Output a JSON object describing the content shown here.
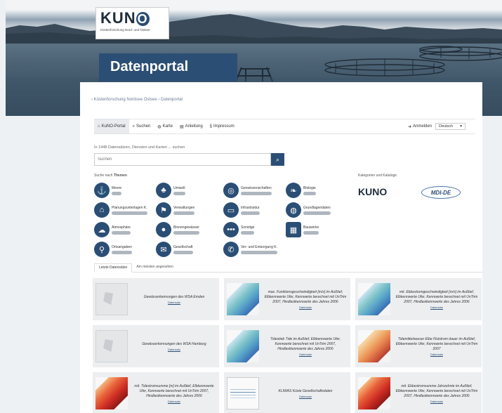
{
  "logo": {
    "name": "KUNO",
    "subtitle": "Küstenforschung Nord- und Ostsee"
  },
  "portal_title": "Datenportal",
  "breadcrumb": {
    "text": "› Küstenforschung Nordsee Ostsee  ›  Datenportal"
  },
  "nav": {
    "items": [
      {
        "icon": "home",
        "label": "KuNO-Portal"
      },
      {
        "icon": "search",
        "label": "Suchen"
      },
      {
        "icon": "globe",
        "label": "Karte"
      },
      {
        "icon": "book",
        "label": "Anleitung"
      },
      {
        "icon": "legal",
        "label": "Impressum"
      }
    ],
    "login": "Anmelden",
    "language": "Deutsch"
  },
  "search": {
    "hint": "In 1448 Datensätzen, Diensten und Karten ... suchen",
    "placeholder": "Suchen"
  },
  "themes_label": {
    "prefix": "Suche nach",
    "bold": "Themen"
  },
  "themes": [
    {
      "icon": "anchor",
      "name": "Meere"
    },
    {
      "icon": "tree",
      "name": "Umwelt"
    },
    {
      "icon": "target",
      "name": "Geowissenschaften"
    },
    {
      "icon": "leaf",
      "name": "Biologie"
    },
    {
      "icon": "building",
      "name": "Planungsunterlagen K."
    },
    {
      "icon": "flag",
      "name": "Verwaltungen"
    },
    {
      "icon": "truck",
      "name": "Infrastruktur"
    },
    {
      "icon": "globe",
      "name": "Grundlagendaten"
    },
    {
      "icon": "cloud",
      "name": "Atmosphäre"
    },
    {
      "icon": "drop",
      "name": "Binnengewässer"
    },
    {
      "icon": "dots",
      "name": "Sonstige"
    },
    {
      "icon": "building",
      "name": "Bauwerke"
    },
    {
      "icon": "pin",
      "name": "Ortsangaben"
    },
    {
      "icon": "chat",
      "name": "Gesellschaft"
    },
    {
      "icon": "phone",
      "name": "Ver- und Entsorgung K."
    }
  ],
  "catalogs_label": "Kategorien und Kataloge",
  "catalogs": {
    "kuno": "KUNO",
    "mdi": "MDI-DE"
  },
  "tabs": [
    {
      "label": "Letzte Datensätze"
    },
    {
      "label": "Am meisten angesehen"
    }
  ],
  "cards": [
    {
      "thumb": "blank",
      "title": "Gewässerkennungen des WSA Emden",
      "link": "Datensatz"
    },
    {
      "thumb": "map-blue",
      "title": "max. Funktionsgeschwindigkeit [m/s] im Außtief, Elbkennwerte Ufer, Kennwerte berechnet mit UnTrim 2007, Hindlastkennwerte des Jahres 2006",
      "link": "Datensatz"
    },
    {
      "thumb": "map-blue",
      "title": "mit. Ebbestromgeschwindigkeit [m/s] im Außtief, Elbkennwerte Ufer, Kennwerte berechnet mit UnTrim 2007, Hindlastkennwerte des Jahres 2006",
      "link": "Datensatz"
    },
    {
      "thumb": "blank",
      "title": "Gewässerkennungen des WSA Hamburg",
      "link": "Datensatz"
    },
    {
      "thumb": "map-blue",
      "title": "Tidestieb Tide im Außtief, Elbkennwerte Ufer, Kennwerte berechnet mit UnTrim 2007, Hindlastkennwerte des Jahres 2006",
      "link": "Datensatz"
    },
    {
      "thumb": "map-warm",
      "title": "Tidemittelwasser Elbe Flutstrom dauer im Außtief, Elbkennwerte Ufer, Kennwerte berechnet mit UnTrim 2007",
      "link": "Datensatz"
    },
    {
      "thumb": "map-red",
      "title": "mit. Tidestromsumme [m] im Außtief, Elbkennwerte Ufer, Kennwerte berechnet mit UnTrim 2007, Hindlastkennwerte des Jahres 2006",
      "link": "Datensatz"
    },
    {
      "thumb": "chart",
      "title": "KLIWAS Küste Gesellschaftsdaten",
      "link": "Datensatz"
    },
    {
      "thumb": "map-red",
      "title": "mit. Ebbestromsumme Jahrzehnte im Außtief, Elbkennwerte Ufer, Kennwerte berechnet mit UnTrim 2007, Hindlastkennwerte des Jahres 2006",
      "link": "Datensatz"
    }
  ],
  "colors": {
    "primary": "#2b4e75",
    "background": "#eef1f4"
  }
}
